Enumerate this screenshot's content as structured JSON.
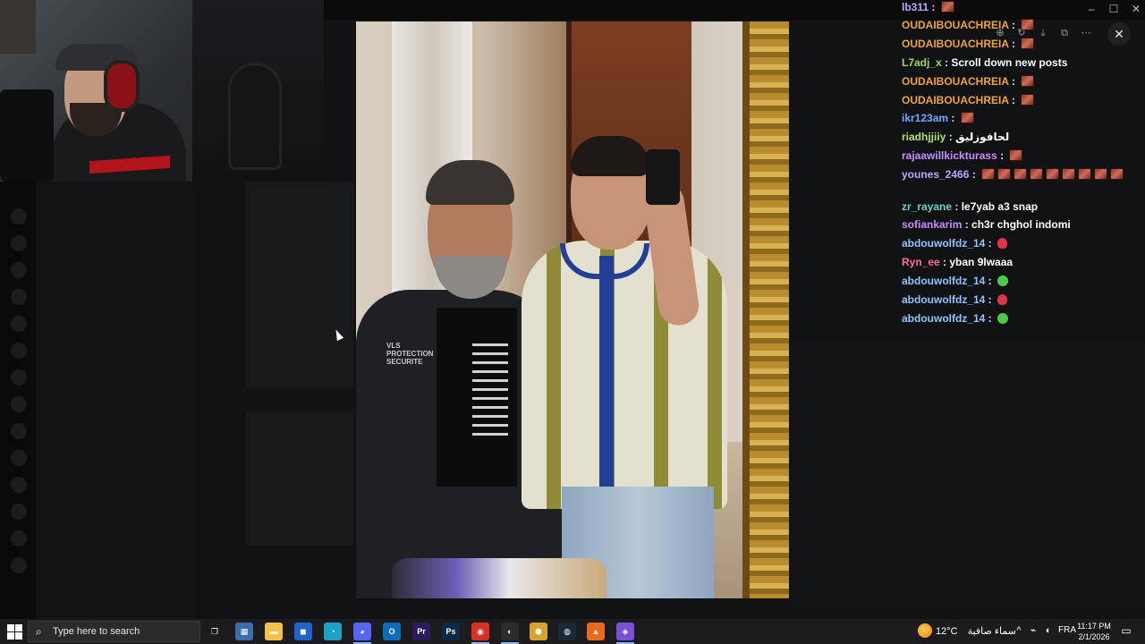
{
  "window": {
    "title": "",
    "controls": {
      "minimize": "–",
      "maximize": "☐",
      "close": "✕"
    }
  },
  "viewer": {
    "controls": [
      "zoom-in-icon",
      "rotate-icon",
      "download-icon",
      "open-external-icon",
      "more-icon"
    ],
    "close_label": "✕"
  },
  "chat": {
    "colors": {
      "orange": "#f0a23c",
      "green": "#9fd65a",
      "blue": "#6fa8ff",
      "purple": "#c98cff",
      "cyan": "#69d0c5",
      "lilac": "#b9a8ff",
      "sky": "#8fc3ff",
      "pink": "#ff6f8a",
      "lime": "#b2e06b",
      "white": "#ffffff"
    },
    "messages": [
      {
        "user": "lb311",
        "color": "#b9a8ff",
        "text": "",
        "emotes": [
          "face"
        ]
      },
      {
        "user": "OUDAIBOUACHREIA",
        "color": "#f0a23c",
        "text": "",
        "emotes": [
          "face"
        ]
      },
      {
        "user": "OUDAIBOUACHREIA",
        "color": "#f0a23c",
        "text": "",
        "emotes": [
          "face"
        ]
      },
      {
        "user": "L7adj_x",
        "color": "#9fd65a",
        "text": "Scroll down new posts",
        "emotes": []
      },
      {
        "user": "OUDAIBOUACHREIA",
        "color": "#f0a23c",
        "text": "",
        "emotes": [
          "face"
        ]
      },
      {
        "user": "OUDAIBOUACHREIA",
        "color": "#f0a23c",
        "text": "",
        "emotes": [
          "face"
        ]
      },
      {
        "user": "ikr123am",
        "color": "#6fa8ff",
        "text": "",
        "emotes": [
          "face"
        ]
      },
      {
        "user": "riadhjjiiy",
        "color": "#b2e06b",
        "text": "لحافوزليق",
        "emotes": []
      },
      {
        "user": "rajaawillkickturass",
        "color": "#c98cff",
        "text": "",
        "emotes": [
          "face"
        ]
      },
      {
        "user": "younes_2466",
        "color": "#b9a8ff",
        "text": "",
        "emotes": [
          "face",
          "face",
          "face",
          "face",
          "face",
          "face",
          "face",
          "face",
          "face"
        ]
      },
      {
        "user": "zr_rayane",
        "color": "#69d0c5",
        "text": "le7yab a3 snap",
        "emotes": []
      },
      {
        "user": "sofiankarim",
        "color": "#c98cff",
        "text": "ch3r chghol indomi",
        "emotes": []
      },
      {
        "user": "abdouwolfdz_14",
        "color": "#8fc3ff",
        "text": "",
        "emotes": [
          "red"
        ]
      },
      {
        "user": "Ryn_ee",
        "color": "#ff6f8a",
        "text": "yban 9lwaaa",
        "emotes": []
      },
      {
        "user": "abdouwolfdz_14",
        "color": "#8fc3ff",
        "text": "",
        "emotes": [
          "green"
        ]
      },
      {
        "user": "abdouwolfdz_14",
        "color": "#8fc3ff",
        "text": "",
        "emotes": [
          "red"
        ]
      },
      {
        "user": "abdouwolfdz_14",
        "color": "#8fc3ff",
        "text": "",
        "emotes": [
          "green"
        ]
      }
    ]
  },
  "taskbar": {
    "search_placeholder": "Type here to search",
    "apps": [
      {
        "name": "task-view-icon",
        "glyph": "❐",
        "color": "#1c1c1e"
      },
      {
        "name": "microsoft-store-icon",
        "glyph": "▦",
        "color": "#3b6ea8"
      },
      {
        "name": "file-explorer-icon",
        "glyph": "▬",
        "color": "#f3c148"
      },
      {
        "name": "windows-app-icon",
        "glyph": "◼",
        "color": "#1f63c9"
      },
      {
        "name": "edge-icon",
        "glyph": "◔",
        "color": "#1ea1c9"
      },
      {
        "name": "discord-icon",
        "glyph": "◕",
        "color": "#5865f2",
        "active": true
      },
      {
        "name": "outlook-icon",
        "glyph": "O",
        "color": "#0f6cbd"
      },
      {
        "name": "premiere-icon",
        "glyph": "Pr",
        "color": "#2a1a5e"
      },
      {
        "name": "photoshop-icon",
        "glyph": "Ps",
        "color": "#0a2a4a"
      },
      {
        "name": "chrome-icon",
        "glyph": "◉",
        "color": "#d93025",
        "active": true
      },
      {
        "name": "obs-icon",
        "glyph": "◐",
        "color": "#2c2c2c",
        "active": true
      },
      {
        "name": "shield-app-icon",
        "glyph": "⬢",
        "color": "#d9a22a"
      },
      {
        "name": "steam-icon",
        "glyph": "◍",
        "color": "#1b2838"
      },
      {
        "name": "vlc-icon",
        "glyph": "▲",
        "color": "#e86a1a"
      },
      {
        "name": "twitch-app-icon",
        "glyph": "◈",
        "color": "#7b4fd6",
        "active": true
      }
    ],
    "weather_temp": "12°C",
    "weather_text": "سماء صافية",
    "language": "FRA",
    "time": "11:17 PM",
    "date": "2/1/2026"
  },
  "photo_badge": "VLS PROTECTION SECURITE"
}
